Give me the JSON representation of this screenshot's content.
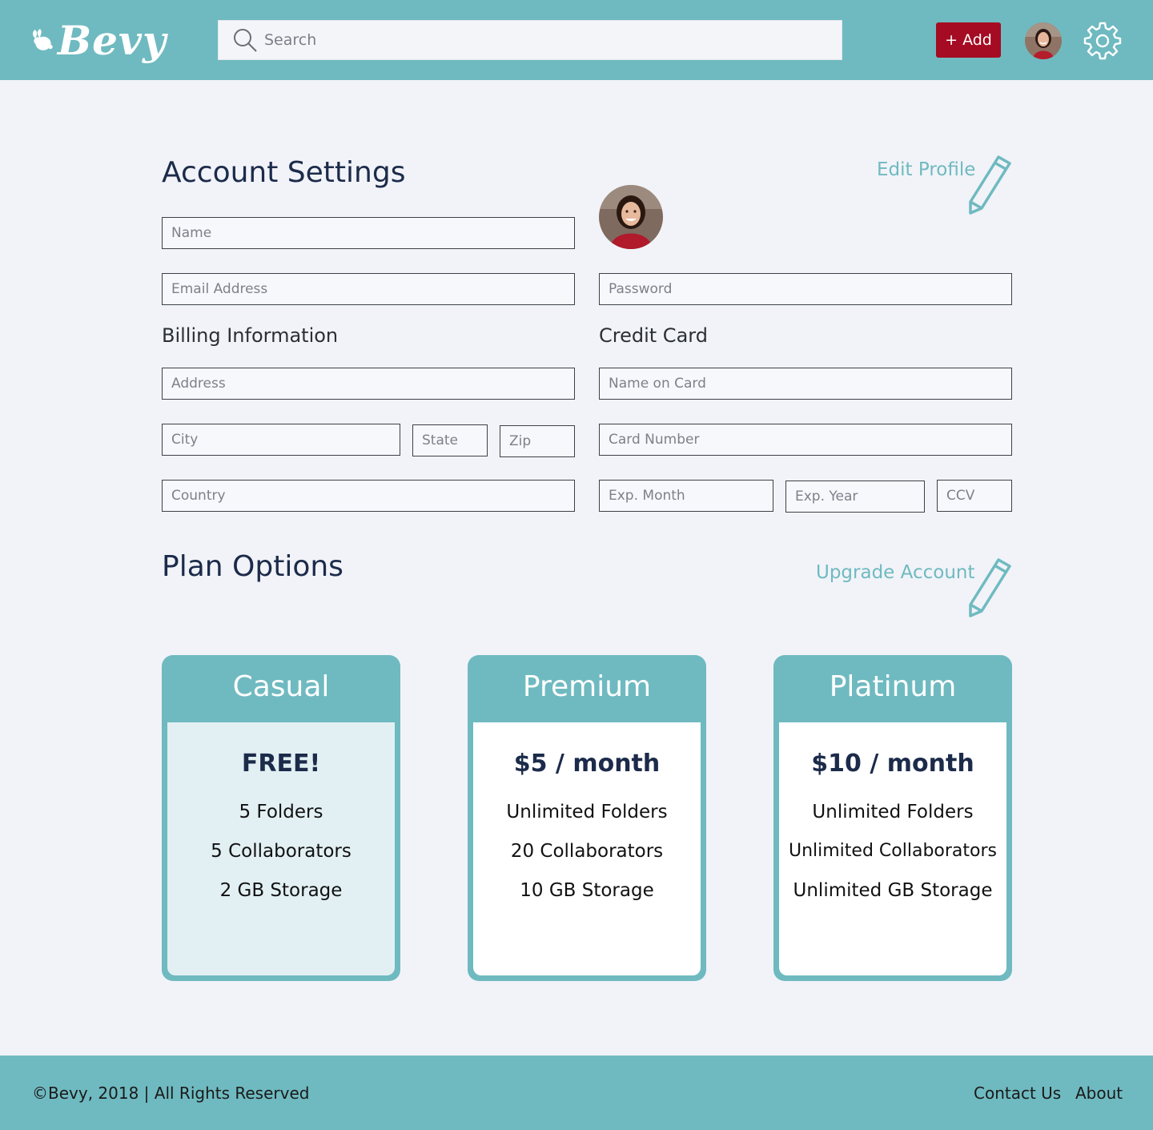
{
  "header": {
    "logo_text": "Bevy",
    "search_placeholder": "Search",
    "add_button_label": "+ Add"
  },
  "account": {
    "title": "Account Settings",
    "edit_profile_label": "Edit Profile",
    "name_placeholder": "Name",
    "email_placeholder": "Email Address",
    "password_placeholder": "Password"
  },
  "billing": {
    "title": "Billing Information",
    "address_placeholder": "Address",
    "city_placeholder": "City",
    "state_placeholder": "State",
    "zip_placeholder": "Zip",
    "country_placeholder": "Country"
  },
  "credit_card": {
    "title": "Credit Card",
    "name_on_card_placeholder": "Name on Card",
    "card_number_placeholder": "Card Number",
    "exp_month_placeholder": "Exp. Month",
    "exp_year_placeholder": "Exp. Year",
    "ccv_placeholder": "CCV"
  },
  "plans": {
    "title": "Plan Options",
    "upgrade_label": "Upgrade Account",
    "items": [
      {
        "name": "Casual",
        "price": "FREE!",
        "features": [
          "5 Folders",
          "5 Collaborators",
          "2 GB Storage"
        ]
      },
      {
        "name": "Premium",
        "price": "$5 / month",
        "features": [
          "Unlimited Folders",
          "20 Collaborators",
          "10 GB Storage"
        ]
      },
      {
        "name": "Platinum",
        "price": "$10 / month",
        "features": [
          "Unlimited Folders",
          "Unlimited Collaborators",
          "Unlimited GB Storage"
        ]
      }
    ]
  },
  "footer": {
    "copyright": "©Bevy, 2018 | All Rights Reserved",
    "contact_label": "Contact Us",
    "about_label": "About"
  },
  "colors": {
    "teal": "#6fbac0",
    "brand_red": "#a50b22",
    "navy": "#1c2b4a",
    "casual_body": "#e2f0f3"
  }
}
